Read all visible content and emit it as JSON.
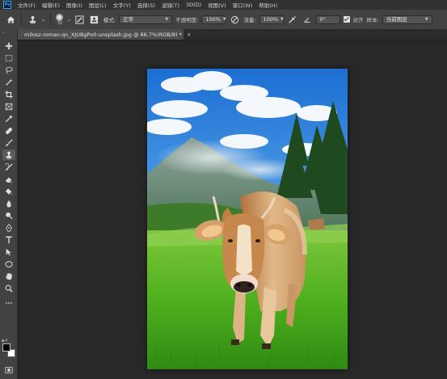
{
  "app": {
    "logo": "Ps"
  },
  "menu": [
    "文件(F)",
    "编辑(E)",
    "图像(I)",
    "图层(L)",
    "文字(Y)",
    "选择(S)",
    "滤镜(T)",
    "3D(D)",
    "视图(V)",
    "窗口(W)",
    "帮助(H)"
  ],
  "options": {
    "brush_size": "32",
    "mode_label": "模式:",
    "mode_value": "正常",
    "opacity_label": "不透明度:",
    "opacity_value": "100%",
    "flow_label": "流量:",
    "flow_value": "100%",
    "angle_value": "0°",
    "aligned_label": "对齐",
    "aligned_checked": true,
    "sample_label": "样本:",
    "sample_value": "当前图层"
  },
  "document": {
    "tab_title": "milosz-roman-qn_XJUBgPo0-unsplash.jpg @ 66.7%(RGB/8) *",
    "zoom": "66.7%",
    "color_mode": "RGB/8"
  },
  "tools": [
    "move-tool",
    "marquee-tool",
    "lasso-tool",
    "magic-wand-tool",
    "crop-tool",
    "frame-tool",
    "eyedropper-tool",
    "healing-brush-tool",
    "brush-tool",
    "clone-stamp-tool",
    "history-brush-tool",
    "eraser-tool",
    "paint-bucket-tool",
    "blur-tool",
    "dodge-tool",
    "pen-tool",
    "type-tool",
    "path-selection-tool",
    "ellipse-tool",
    "hand-tool",
    "zoom-tool",
    "more-tools"
  ],
  "active_tool": "clone-stamp-tool",
  "colors": {
    "foreground": "#000000",
    "background": "#ffffff",
    "chrome": "#424242",
    "menubar": "#323232",
    "workspace": "#282828"
  }
}
